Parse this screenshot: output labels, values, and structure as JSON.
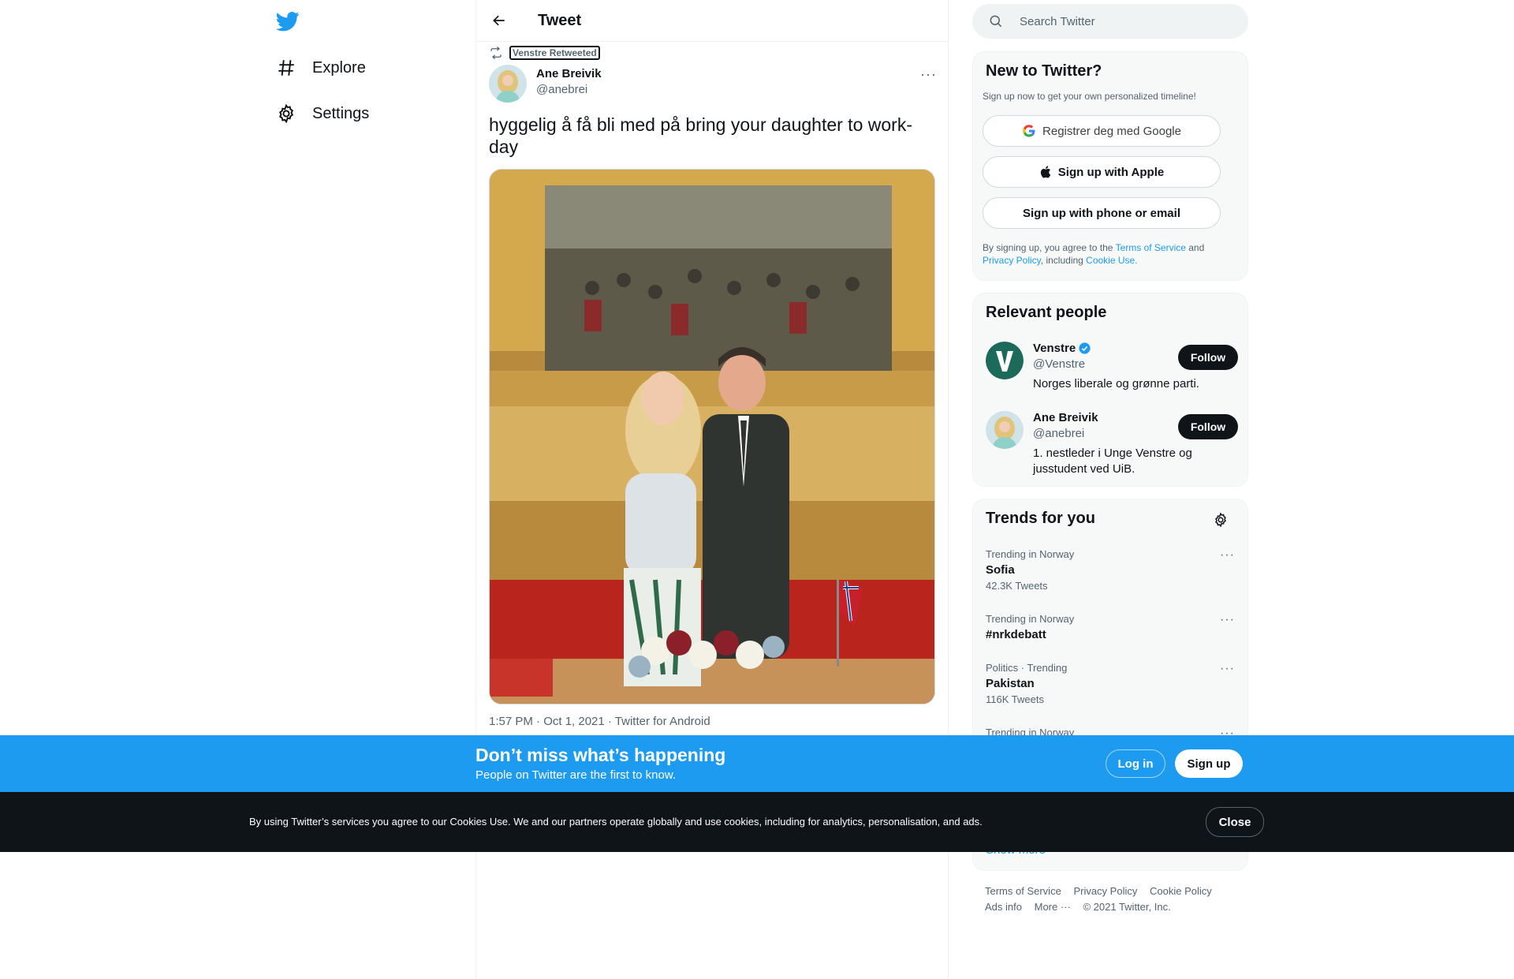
{
  "nav": {
    "explore": "Explore",
    "settings": "Settings"
  },
  "header": {
    "title": "Tweet"
  },
  "tweet": {
    "retweet_label": "Venstre Retweeted",
    "author_name": "Ane Breivik",
    "author_handle": "@anebrei",
    "text": "hyggelig å få bli med på bring your daughter to work-day",
    "meta": "1:57 PM · Oct 1, 2021 · Twitter for Android"
  },
  "search": {
    "placeholder": "Search Twitter"
  },
  "new_to_twitter": {
    "title": "New to Twitter?",
    "subtitle": "Sign up now to get your own personalized timeline!",
    "google_btn": "Registrer deg med Google",
    "apple_btn": "Sign up with Apple",
    "phone_btn": "Sign up with phone or email",
    "terms_prefix": "By signing up, you agree to the ",
    "terms_link": "Terms of Service",
    "terms_and": " and",
    "privacy_link": "Privacy Policy",
    "including": ", including ",
    "cookie_link": "Cookie Use."
  },
  "relevant": {
    "title": "Relevant people",
    "people": [
      {
        "name": "Venstre",
        "handle": "@Venstre",
        "bio": "Norges liberale og grønne parti.",
        "follow": "Follow"
      },
      {
        "name": "Ane Breivik",
        "handle": "@anebrei",
        "bio": "1. nestleder i Unge Venstre og jusstudent ved UiB.",
        "follow": "Follow"
      }
    ]
  },
  "trends": {
    "title": "Trends for you",
    "items": [
      {
        "context": "Trending in Norway",
        "name": "Sofia",
        "count": "42.3K Tweets"
      },
      {
        "context": "Trending in Norway",
        "name": "#nrkdebatt",
        "count": ""
      },
      {
        "context": "Politics · Trending",
        "name": "Pakistan",
        "count": "116K Tweets"
      },
      {
        "context": "Trending in Norway",
        "name": "",
        "count": ""
      }
    ],
    "show_more": "Show more"
  },
  "footer": {
    "terms": "Terms of Service",
    "privacy": "Privacy Policy",
    "cookie": "Cookie Policy",
    "ads": "Ads info",
    "more": "More ···",
    "copyright": "© 2021 Twitter, Inc."
  },
  "signup_bar": {
    "title": "Don’t miss what’s happening",
    "subtitle": "People on Twitter are the first to know.",
    "login": "Log in",
    "signup": "Sign up"
  },
  "cookie_bar": {
    "text": "By using Twitter’s services you agree to our Cookies Use. We and our partners operate globally and use cookies, including for analytics, personalisation, and ads.",
    "close": "Close"
  },
  "colors": {
    "brand": "#1d9bf0",
    "text": "#0f1419",
    "secondary": "#536471",
    "cookie_bg": "#0f1419"
  },
  "icons": [
    "twitter-logo-icon",
    "hashtag-icon",
    "gear-icon",
    "back-arrow-icon",
    "retweet-icon",
    "search-icon",
    "google-icon",
    "apple-icon",
    "verified-icon",
    "more-icon"
  ]
}
